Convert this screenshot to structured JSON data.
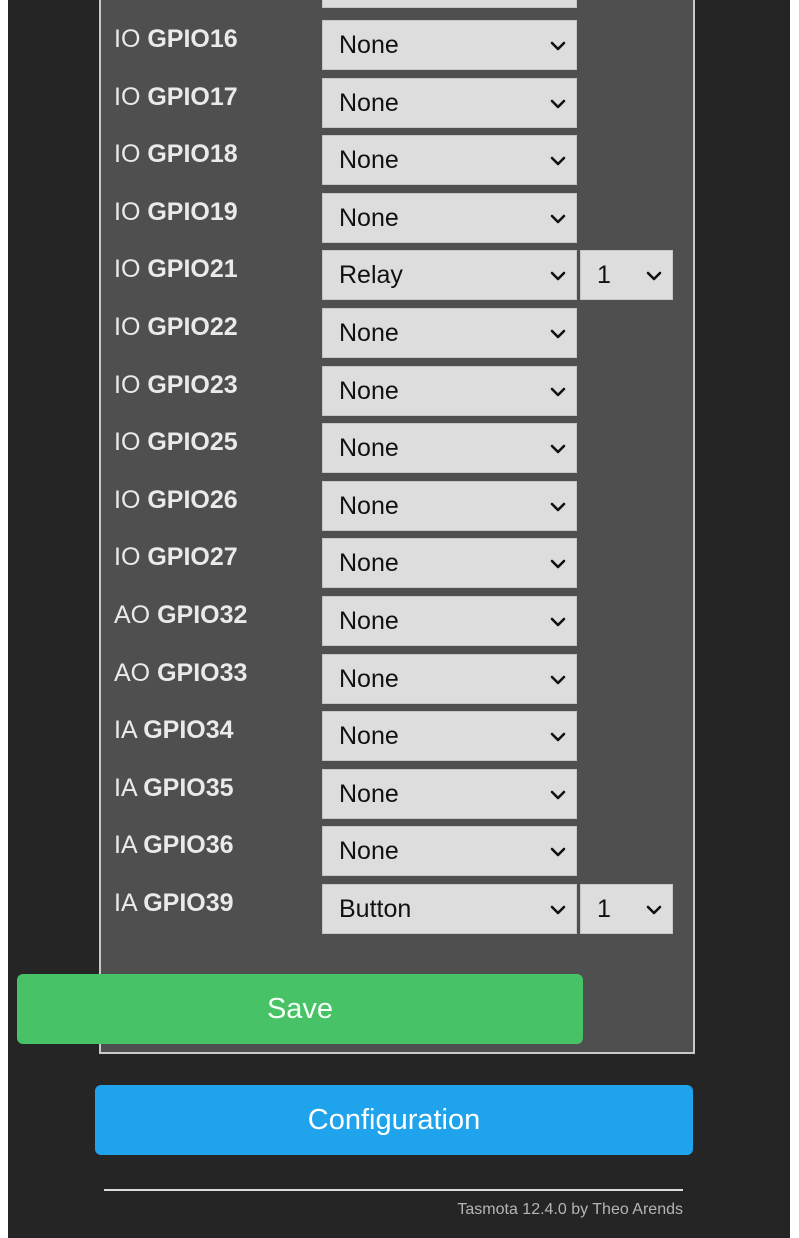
{
  "gpio_rows": [
    {
      "prefix": "IO",
      "pin": "GPIO16",
      "function": "None"
    },
    {
      "prefix": "IO",
      "pin": "GPIO17",
      "function": "None"
    },
    {
      "prefix": "IO",
      "pin": "GPIO18",
      "function": "None"
    },
    {
      "prefix": "IO",
      "pin": "GPIO19",
      "function": "None"
    },
    {
      "prefix": "IO",
      "pin": "GPIO21",
      "function": "Relay",
      "index": "1"
    },
    {
      "prefix": "IO",
      "pin": "GPIO22",
      "function": "None"
    },
    {
      "prefix": "IO",
      "pin": "GPIO23",
      "function": "None"
    },
    {
      "prefix": "IO",
      "pin": "GPIO25",
      "function": "None"
    },
    {
      "prefix": "IO",
      "pin": "GPIO26",
      "function": "None"
    },
    {
      "prefix": "IO",
      "pin": "GPIO27",
      "function": "None"
    },
    {
      "prefix": "AO",
      "pin": "GPIO32",
      "function": "None"
    },
    {
      "prefix": "AO",
      "pin": "GPIO33",
      "function": "None"
    },
    {
      "prefix": "IA",
      "pin": "GPIO34",
      "function": "None"
    },
    {
      "prefix": "IA",
      "pin": "GPIO35",
      "function": "None"
    },
    {
      "prefix": "IA",
      "pin": "GPIO36",
      "function": "None"
    },
    {
      "prefix": "IA",
      "pin": "GPIO39",
      "function": "Button",
      "index": "1"
    }
  ],
  "buttons": {
    "save": "Save",
    "configuration": "Configuration"
  },
  "footer": {
    "text": "Tasmota 12.4.0 by Theo Arends"
  },
  "colors": {
    "save_green": "#47c266",
    "config_blue": "#1fa3ec",
    "page_bg": "#252525",
    "panel_bg": "#4f4f4f"
  },
  "icons": {
    "dropdown": "chevron-down-icon"
  }
}
